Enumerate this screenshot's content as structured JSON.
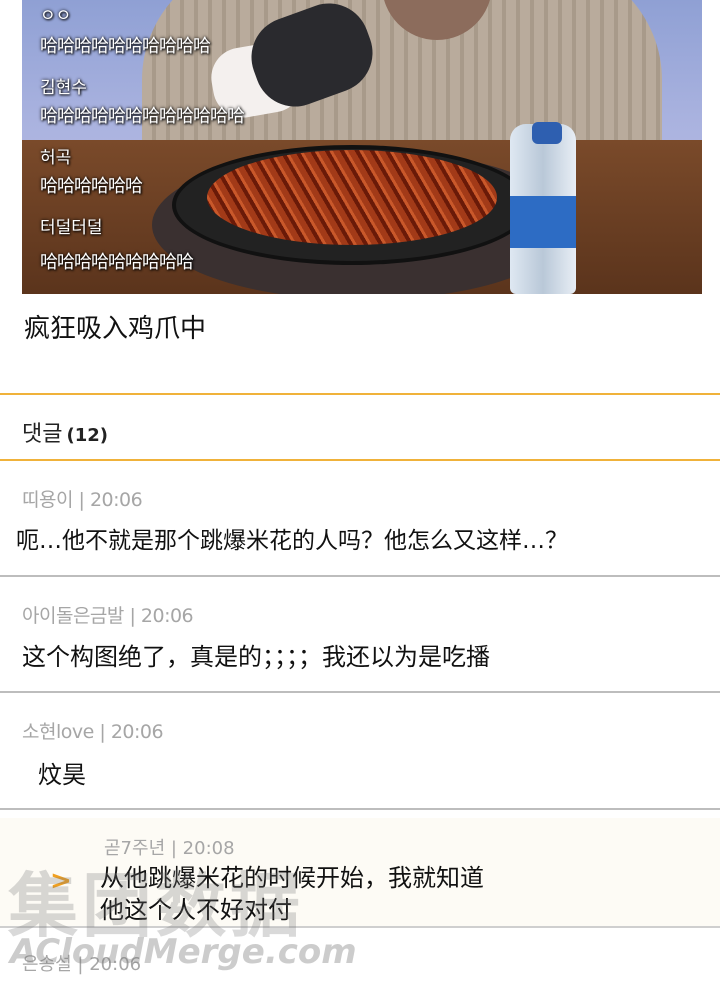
{
  "stream": {
    "chat": [
      {
        "name": "ㅇㅇ",
        "text": "哈哈哈哈哈哈哈哈哈哈"
      },
      {
        "name": "김현수",
        "text": "哈哈哈哈哈哈哈哈哈哈哈哈"
      },
      {
        "name": "허곡",
        "text": "哈哈哈哈哈哈"
      },
      {
        "name": "터덜터덜",
        "text": "哈哈哈哈哈哈哈哈哈"
      }
    ],
    "caption": "疯狂吸入鸡爪中"
  },
  "comments": {
    "label": "댓글",
    "count": "(12)",
    "items": [
      {
        "author": "띠용이",
        "time": "20:06",
        "text": "呃…他不就是那个跳爆米花的人吗？他怎么又这样…？"
      },
      {
        "author": "아이돌은금발",
        "time": "20:06",
        "text": "这个构图绝了，真是的；；；；我还以为是吃播"
      },
      {
        "author": "소현love",
        "time": "20:06",
        "text": "炆昊"
      }
    ],
    "reply": {
      "author": "곧7주년",
      "time": "20:08",
      "line1": "从他跳爆米花的时候开始，我就知道",
      "line2": "他这个人不好对付"
    },
    "last": {
      "author": "은송설",
      "time": "20:06"
    }
  },
  "watermark": {
    "big": "集团数据",
    "url": "ACloudMerge.com"
  },
  "colors": {
    "accent": "#f0b23a",
    "reply_arrow": "#f0a020",
    "meta": "#a6a6a6"
  },
  "icons": {
    "reply": "reply-arrow-icon"
  }
}
